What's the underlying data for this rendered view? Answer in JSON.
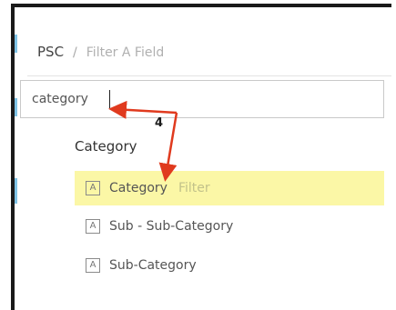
{
  "header": {
    "title": "PSC",
    "separator": "/",
    "crumb": "Filter A Field"
  },
  "search": {
    "value": "category"
  },
  "results": {
    "group_title": "Category",
    "items": [
      {
        "type_icon": "A",
        "label": "Category",
        "hint": "Filter",
        "highlighted": true
      },
      {
        "type_icon": "A",
        "label": "Sub - Sub-Category",
        "highlighted": false
      },
      {
        "type_icon": "A",
        "label": "Sub-Category",
        "highlighted": false
      }
    ]
  },
  "annotation": {
    "step": "4",
    "arrow_color": "#e03a1e"
  },
  "colors": {
    "highlight": "#fbf7a6",
    "accent": "#7fc3e6"
  }
}
